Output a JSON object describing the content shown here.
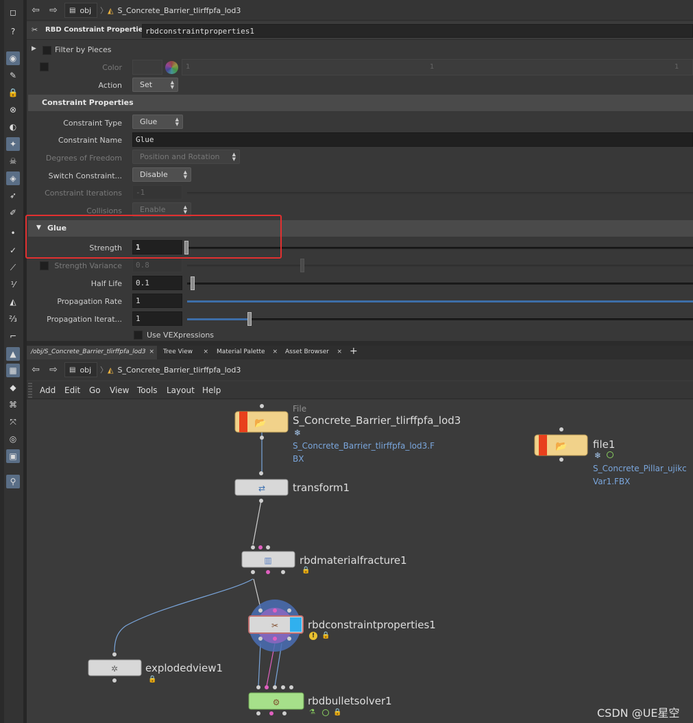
{
  "path": {
    "network": "obj",
    "node": "S_Concrete_Barrier_tlirffpfa_lod3"
  },
  "params": {
    "node_type": "RBD Constraint Properties",
    "node_name": "rbdconstraintproperties1",
    "filter_label": "Filter by Pieces",
    "color_label": "Color",
    "color_values": [
      "1",
      "1",
      "1"
    ],
    "action_label": "Action",
    "action_value": "Set",
    "section_constraint": "Constraint Properties",
    "constraint_type_label": "Constraint Type",
    "constraint_type_value": "Glue",
    "constraint_name_label": "Constraint Name",
    "constraint_name_value": "Glue",
    "dof_label": "Degrees of Freedom",
    "dof_value": "Position and Rotation",
    "switch_label": "Switch Constraint...",
    "switch_value": "Disable",
    "iterations_label": "Constraint Iterations",
    "iterations_value": "-1",
    "collisions_label": "Collisions",
    "collisions_value": "Enable",
    "section_glue": "Glue",
    "strength_label": "Strength",
    "strength_value": "1",
    "variance_label": "Strength Variance",
    "variance_value": "0.8",
    "halflife_label": "Half Life",
    "halflife_value": "0.1",
    "proprate_label": "Propagation Rate",
    "proprate_value": "1",
    "propiter_label": "Propagation Iterat...",
    "propiter_value": "1",
    "vex_label": "Use VEXpressions"
  },
  "tabs": [
    {
      "label": "/obj/S_Concrete_Barrier_tlirffpfa_lod3"
    },
    {
      "label": "Tree View"
    },
    {
      "label": "Material Palette"
    },
    {
      "label": "Asset Browser"
    }
  ],
  "tab_add": "+",
  "tab_close": "×",
  "menu": [
    "Add",
    "Edit",
    "Go",
    "View",
    "Tools",
    "Layout",
    "Help"
  ],
  "nodes": {
    "file_category": "File",
    "file_name": "S_Concrete_Barrier_tlirffpfa_lod3",
    "file_path_line1": "S_Concrete_Barrier_tlirffpfa_lod3.F",
    "file_path_line2": "BX",
    "file1_name": "file1",
    "file1_path_line1": "S_Concrete_Pillar_ujikc",
    "file1_path_line2": "Var1.FBX",
    "transform": "transform1",
    "fracture": "rbdmaterialfracture1",
    "constraint": "rbdconstraintproperties1",
    "exploded": "explodedview1",
    "solver": "rbdbulletsolver1"
  },
  "watermark": "CSDN @UE星空",
  "colors": {
    "highlight": "#e23030",
    "accent": "#3d6ea8",
    "wire": "#7aa6dc"
  }
}
